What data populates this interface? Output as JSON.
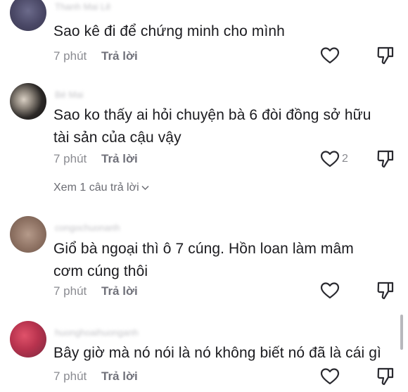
{
  "comments": [
    {
      "text": "Sao kê đi để chứng minh cho mình",
      "time": "7 phút",
      "reply": "Trả lời",
      "likes": ""
    },
    {
      "text": "Sao ko thấy ai hỏi chuyện bà 6 đòi đồng sở hữu tài sản của cậu vậy",
      "time": "7 phút",
      "reply": "Trả lời",
      "likes": "2",
      "view_replies": "Xem 1 câu trả lời"
    },
    {
      "text": "Giổ bà ngoại thì ô 7 cúng. Hồn loan làm mâm cơm cúng thôi",
      "time": "7 phút",
      "reply": "Trả lời",
      "likes": ""
    },
    {
      "text": "Bây giờ mà nó nói là nó không biết nó đã là cái gì",
      "time": "7 phút",
      "reply": "Trả lời",
      "likes": ""
    }
  ],
  "icons": {
    "like": "heart-outline-icon",
    "dislike": "thumbs-down-outline-icon",
    "expand": "chevron-down-icon"
  },
  "colors": {
    "text": "#1b1b1f",
    "meta": "#8a8b91",
    "icon": "#2a2a30"
  }
}
